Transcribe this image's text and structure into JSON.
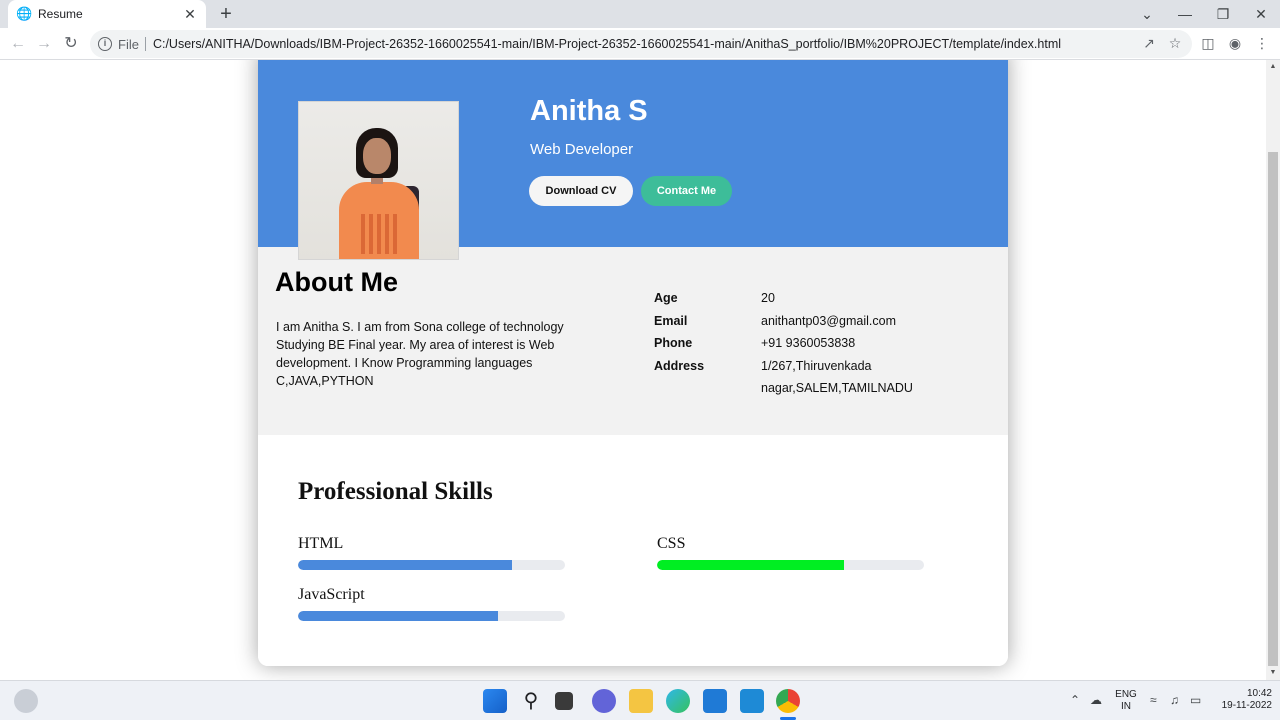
{
  "browser": {
    "tab_title": "Resume",
    "new_tab": "+",
    "close": "✕",
    "scheme": "File",
    "url": "C:/Users/ANITHA/Downloads/IBM-Project-26352-1660025541-main/IBM-Project-26352-1660025541-main/AnithaS_portfolio/IBM%20PROJECT/template/index.html"
  },
  "hero": {
    "name": "Anitha S",
    "role": "Web Developer",
    "download_label": "Download CV",
    "contact_label": "Contact Me"
  },
  "about": {
    "heading": "About Me",
    "bio": "I am Anitha S. I am from Sona college of technology Studying BE Final year. My area of interest is Web development. I Know Programming languages C,JAVA,PYTHON",
    "info": [
      {
        "key": "Age",
        "value": "20"
      },
      {
        "key": "Email",
        "value": "anithantp03@gmail.com"
      },
      {
        "key": "Phone",
        "value": "+91 9360053838"
      },
      {
        "key": "Address",
        "value": "1/267,Thiruvenkada nagar,SALEM,TAMILNADU"
      }
    ]
  },
  "skills": {
    "heading": "Professional Skills",
    "items": [
      {
        "name": "HTML",
        "level": 0.8,
        "color": "#4a89dc"
      },
      {
        "name": "CSS",
        "level": 0.7,
        "color": "#00ee22"
      },
      {
        "name": "JavaScript",
        "level": 0.75,
        "color": "#4a89dc"
      }
    ]
  },
  "taskbar": {
    "lang_top": "ENG",
    "lang_bottom": "IN",
    "time": "10:42",
    "date": "19-11-2022"
  },
  "colors": {
    "hero_bg": "#4a89dc",
    "contact_btn": "#3dbd99",
    "about_bg": "#f2f2f2"
  }
}
